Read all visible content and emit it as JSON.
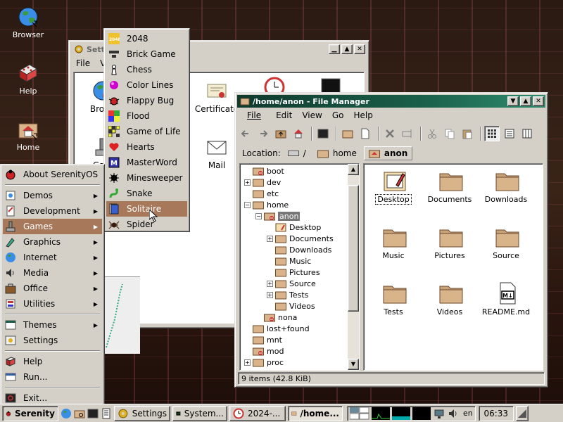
{
  "desktop": {
    "icons": [
      {
        "label": "Browser",
        "icon": "browser-globe-icon"
      },
      {
        "label": "Help",
        "icon": "help-book-icon"
      },
      {
        "label": "Home",
        "icon": "home-folder-icon"
      }
    ]
  },
  "settings_window": {
    "title": "Sett",
    "menu": [
      "File",
      "V"
    ],
    "icons": [
      {
        "label": "Brows",
        "icon": "browser-settings-icon"
      },
      {
        "label": "Certificate",
        "icon": "certificate-icon"
      },
      {
        "label": "Mail",
        "icon": "mail-icon"
      },
      {
        "label": "Gam",
        "icon": "games-settings-icon"
      }
    ]
  },
  "file_manager": {
    "title": "/home/anon - File Manager",
    "menu": [
      "File",
      "Edit",
      "View",
      "Go",
      "Help"
    ],
    "location_label": "Location:",
    "breadcrumbs": [
      "/",
      "home",
      "anon"
    ],
    "tree": [
      {
        "label": "boot",
        "depth": 1
      },
      {
        "label": "dev",
        "depth": 1
      },
      {
        "label": "etc",
        "depth": 1
      },
      {
        "label": "home",
        "depth": 1
      },
      {
        "label": "anon",
        "depth": 2
      },
      {
        "label": "Desktop",
        "depth": 3
      },
      {
        "label": "Documents",
        "depth": 3
      },
      {
        "label": "Downloads",
        "depth": 3
      },
      {
        "label": "Music",
        "depth": 3
      },
      {
        "label": "Pictures",
        "depth": 3
      },
      {
        "label": "Source",
        "depth": 3
      },
      {
        "label": "Tests",
        "depth": 3
      },
      {
        "label": "Videos",
        "depth": 3
      },
      {
        "label": "nona",
        "depth": 2
      },
      {
        "label": "lost+found",
        "depth": 1
      },
      {
        "label": "mnt",
        "depth": 1
      },
      {
        "label": "mod",
        "depth": 1
      },
      {
        "label": "proc",
        "depth": 1
      }
    ],
    "items": [
      {
        "label": "Desktop",
        "icon": "desktop-folder-icon"
      },
      {
        "label": "Documents",
        "icon": "folder-icon"
      },
      {
        "label": "Downloads",
        "icon": "folder-icon"
      },
      {
        "label": "Music",
        "icon": "folder-icon"
      },
      {
        "label": "Pictures",
        "icon": "folder-icon"
      },
      {
        "label": "Source",
        "icon": "folder-icon"
      },
      {
        "label": "Tests",
        "icon": "folder-icon"
      },
      {
        "label": "Videos",
        "icon": "folder-icon"
      },
      {
        "label": "README.md",
        "icon": "markdown-file-icon"
      }
    ],
    "status": "9 items (42.8 KiB)"
  },
  "start_menu": {
    "items": [
      {
        "label": "About SerenityOS",
        "icon": "serenity-ladybug-icon",
        "submenu": false
      },
      {
        "label": "Demos",
        "icon": "demos-icon",
        "submenu": true
      },
      {
        "label": "Development",
        "icon": "development-icon",
        "submenu": true
      },
      {
        "label": "Games",
        "icon": "games-icon",
        "submenu": true
      },
      {
        "label": "Graphics",
        "icon": "graphics-icon",
        "submenu": true
      },
      {
        "label": "Internet",
        "icon": "internet-icon",
        "submenu": true
      },
      {
        "label": "Media",
        "icon": "media-icon",
        "submenu": true
      },
      {
        "label": "Office",
        "icon": "office-icon",
        "submenu": true
      },
      {
        "label": "Utilities",
        "icon": "utilities-icon",
        "submenu": true
      },
      {
        "label": "Themes",
        "icon": "themes-icon",
        "submenu": true
      },
      {
        "label": "Settings",
        "icon": "settings-icon",
        "submenu": false
      },
      {
        "label": "Help",
        "icon": "help-icon",
        "submenu": false
      },
      {
        "label": "Run...",
        "icon": "run-icon",
        "submenu": false
      },
      {
        "label": "Exit...",
        "icon": "exit-icon",
        "submenu": false
      }
    ]
  },
  "games_menu": {
    "items": [
      {
        "label": "2048",
        "icon": "2048-icon"
      },
      {
        "label": "Brick Game",
        "icon": "brick-game-icon"
      },
      {
        "label": "Chess",
        "icon": "chess-icon"
      },
      {
        "label": "Color Lines",
        "icon": "color-lines-icon"
      },
      {
        "label": "Flappy Bug",
        "icon": "flappy-bug-icon"
      },
      {
        "label": "Flood",
        "icon": "flood-icon"
      },
      {
        "label": "Game of Life",
        "icon": "game-of-life-icon"
      },
      {
        "label": "Hearts",
        "icon": "hearts-icon"
      },
      {
        "label": "MasterWord",
        "icon": "masterword-icon"
      },
      {
        "label": "Minesweeper",
        "icon": "minesweeper-icon"
      },
      {
        "label": "Snake",
        "icon": "snake-icon"
      },
      {
        "label": "Solitaire",
        "icon": "solitaire-icon"
      },
      {
        "label": "Spider",
        "icon": "spider-icon"
      }
    ],
    "highlighted": "Solitaire"
  },
  "taskbar": {
    "start_label": "Serenity",
    "tasks": [
      {
        "label": "Settings",
        "icon": "settings-gear-icon"
      },
      {
        "label": "System...",
        "icon": "system-monitor-icon"
      },
      {
        "label": "2024-...",
        "icon": "clock-icon"
      },
      {
        "label": "/home...",
        "icon": "folder-icon"
      }
    ],
    "keyboard_layout": "en",
    "clock": "06:33"
  },
  "colors": {
    "accent": "#a8785a",
    "titlebar": "#1a5f4a",
    "chrome": "#d4d0c8"
  }
}
